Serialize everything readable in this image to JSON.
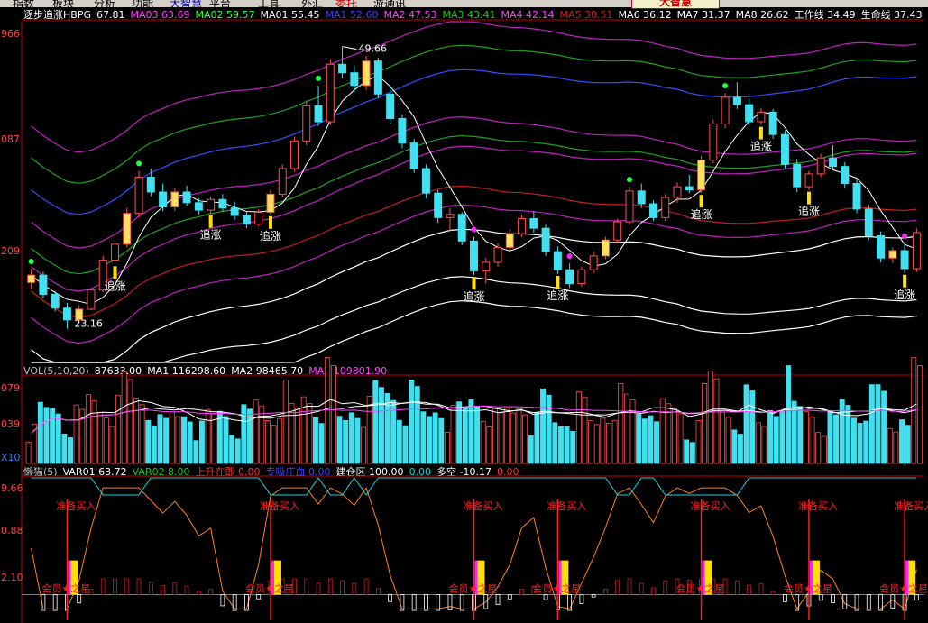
{
  "menu": [
    {
      "label": "指数"
    },
    {
      "label": "板块"
    },
    {
      "label": "分析"
    },
    {
      "label": "功能"
    },
    {
      "label": "大智慧",
      "color": "#0000c0"
    },
    {
      "label": "平台"
    },
    {
      "label": "工具"
    },
    {
      "label": "外汇"
    },
    {
      "label": "委托",
      "color": "#c00000"
    },
    {
      "label": "游通讯"
    }
  ],
  "logo_text": "大智慧",
  "main_header": {
    "indicator": "逐步追涨HBPG",
    "items": [
      {
        "label": "67.81",
        "color": "#ffffff"
      },
      {
        "label": "MA03 63.69",
        "color": "#ff40ff"
      },
      {
        "label": "MA02 59.57",
        "color": "#40ff40"
      },
      {
        "label": "MA01 55.45",
        "color": "#ffffff"
      },
      {
        "label": "MA1 52.60",
        "color": "#4040ff"
      },
      {
        "label": "MA2 47.53",
        "color": "#ff40ff"
      },
      {
        "label": "MA3 43.41",
        "color": "#20c020"
      },
      {
        "label": "MA4 42.14",
        "color": "#ff40ff"
      },
      {
        "label": "MA5 38.51",
        "color": "#c02020"
      },
      {
        "label": "MA6 36.12",
        "color": "#ffffff"
      },
      {
        "label": "MA7 31.37",
        "color": "#ffffff"
      },
      {
        "label": "MA8 26.62",
        "color": "#ffffff"
      },
      {
        "label": "工作线 34.49",
        "color": "#ffffff"
      },
      {
        "label": "生命线 37.43",
        "color": "#ffffff"
      }
    ]
  },
  "main_axis_labels": [
    "966",
    "087",
    "209"
  ],
  "vol_axis_labels": [
    "079",
    "039",
    "X10"
  ],
  "sub_axis_labels": [
    "9.66",
    "0.88",
    "2.10"
  ],
  "vol_header": {
    "items": [
      {
        "label": "VOL(5,10,20)",
        "color": "#c0c0c0"
      },
      {
        "label": "87633.00",
        "color": "#ffffff"
      },
      {
        "label": "MA1 116298.60",
        "color": "#ffffff"
      },
      {
        "label": "MA2 98465.70",
        "color": "#ffffff"
      },
      {
        "label": "MA3 109801.90",
        "color": "#ff40ff"
      }
    ]
  },
  "sub_header": {
    "items": [
      {
        "label": "懒猫(5)",
        "color": "#c0c0c0"
      },
      {
        "label": "VAR01 63.72",
        "color": "#ffffff"
      },
      {
        "label": "VAR02 8.00",
        "color": "#20c020"
      },
      {
        "label": "上升在即 0.00",
        "color": "#ff3030"
      },
      {
        "label": "专吸庄血 0.00",
        "color": "#4040ff"
      },
      {
        "label": "建仓区 100.00",
        "color": "#ffffff"
      },
      {
        "label": "0.00",
        "color": "#00e0e0"
      },
      {
        "label": "多空 -10.17",
        "color": "#ffffff"
      },
      {
        "label": "0.00",
        "color": "#ff3030"
      }
    ]
  },
  "annotations": {
    "high": "49.66",
    "low": "23.16",
    "chase": "追涨",
    "prepare": "准备买入",
    "star": "会员★之星"
  },
  "chart_data": {
    "type": "candlestick",
    "price_range": [
      20,
      52
    ],
    "high": 49.66,
    "low": 23.16,
    "candles_ohlc": [
      [
        27.5,
        28.8,
        26.9,
        28.2
      ],
      [
        28.2,
        28.5,
        26.0,
        26.4
      ],
      [
        26.4,
        26.7,
        24.8,
        25.1
      ],
      [
        25.1,
        25.6,
        23.16,
        24.0
      ],
      [
        24.0,
        25.4,
        23.7,
        25.0
      ],
      [
        25.0,
        27.0,
        24.9,
        26.8
      ],
      [
        26.8,
        30.0,
        26.6,
        29.6
      ],
      [
        29.6,
        31.5,
        29.2,
        31.1
      ],
      [
        31.1,
        34.5,
        30.8,
        34.0
      ],
      [
        34.0,
        38.0,
        33.6,
        37.4
      ],
      [
        37.4,
        38.2,
        35.6,
        36.0
      ],
      [
        36.0,
        36.8,
        34.2,
        34.6
      ],
      [
        34.6,
        36.4,
        34.2,
        36.0
      ],
      [
        36.0,
        36.6,
        34.7,
        35.0
      ],
      [
        35.0,
        35.4,
        33.9,
        34.3
      ],
      [
        34.3,
        35.6,
        34.0,
        35.3
      ],
      [
        35.3,
        35.8,
        34.2,
        34.5
      ],
      [
        34.5,
        35.1,
        33.4,
        33.8
      ],
      [
        33.8,
        34.2,
        32.6,
        33.0
      ],
      [
        33.0,
        34.4,
        32.8,
        34.1
      ],
      [
        34.1,
        36.2,
        33.9,
        35.8
      ],
      [
        35.8,
        38.6,
        35.5,
        38.2
      ],
      [
        38.2,
        41.2,
        37.9,
        40.8
      ],
      [
        40.8,
        44.6,
        40.4,
        44.1
      ],
      [
        44.1,
        46.0,
        42.2,
        42.6
      ],
      [
        42.6,
        48.5,
        42.3,
        48.0
      ],
      [
        48.0,
        49.66,
        46.7,
        47.2
      ],
      [
        47.2,
        47.9,
        45.4,
        46.0
      ],
      [
        46.0,
        48.8,
        45.6,
        48.3
      ],
      [
        48.3,
        48.6,
        44.8,
        45.2
      ],
      [
        45.2,
        46.0,
        42.4,
        42.9
      ],
      [
        42.9,
        43.3,
        40.1,
        40.6
      ],
      [
        40.6,
        41.0,
        37.8,
        38.2
      ],
      [
        38.2,
        38.6,
        35.4,
        35.9
      ],
      [
        35.9,
        36.2,
        33.1,
        33.6
      ],
      [
        33.6,
        34.5,
        32.3,
        33.9
      ],
      [
        33.9,
        34.1,
        31.0,
        31.4
      ],
      [
        31.4,
        31.8,
        28.2,
        28.6
      ],
      [
        28.6,
        29.8,
        27.4,
        29.4
      ],
      [
        29.4,
        31.2,
        29.0,
        30.8
      ],
      [
        30.8,
        32.5,
        30.5,
        32.1
      ],
      [
        32.1,
        33.9,
        31.8,
        33.5
      ],
      [
        33.5,
        34.2,
        32.2,
        32.6
      ],
      [
        32.6,
        33.0,
        30.0,
        30.4
      ],
      [
        30.4,
        30.9,
        28.3,
        28.7
      ],
      [
        28.7,
        29.3,
        27.0,
        27.4
      ],
      [
        27.4,
        29.0,
        27.1,
        28.7
      ],
      [
        28.7,
        30.4,
        28.4,
        30.0
      ],
      [
        30.0,
        31.8,
        29.7,
        31.5
      ],
      [
        31.5,
        33.5,
        31.2,
        33.2
      ],
      [
        33.2,
        36.5,
        32.9,
        36.1
      ],
      [
        36.1,
        36.8,
        34.5,
        34.9
      ],
      [
        34.9,
        35.2,
        33.3,
        33.6
      ],
      [
        33.6,
        35.8,
        33.3,
        35.5
      ],
      [
        35.5,
        36.9,
        35.0,
        36.5
      ],
      [
        36.5,
        37.6,
        35.9,
        36.2
      ],
      [
        36.2,
        39.4,
        35.9,
        39.0
      ],
      [
        39.0,
        42.8,
        38.7,
        42.4
      ],
      [
        42.4,
        45.3,
        42.0,
        44.9
      ],
      [
        44.9,
        46.3,
        43.8,
        44.2
      ],
      [
        44.2,
        44.8,
        42.2,
        42.6
      ],
      [
        42.6,
        43.9,
        42.3,
        43.5
      ],
      [
        43.5,
        43.8,
        41.0,
        41.4
      ],
      [
        41.4,
        41.8,
        38.2,
        38.6
      ],
      [
        38.6,
        39.1,
        36.0,
        36.5
      ],
      [
        36.5,
        38.0,
        36.2,
        37.7
      ],
      [
        37.7,
        39.6,
        37.4,
        39.2
      ],
      [
        39.2,
        40.4,
        38.0,
        38.4
      ],
      [
        38.4,
        38.8,
        36.4,
        36.8
      ],
      [
        36.8,
        37.2,
        34.0,
        34.4
      ],
      [
        34.4,
        34.8,
        31.5,
        31.9
      ],
      [
        31.9,
        32.3,
        29.4,
        29.8
      ],
      [
        29.8,
        30.8,
        29.3,
        30.5
      ],
      [
        30.5,
        31.2,
        28.4,
        28.8
      ],
      [
        28.8,
        32.6,
        28.5,
        32.2
      ]
    ],
    "indicator_signal_label": "追涨"
  }
}
